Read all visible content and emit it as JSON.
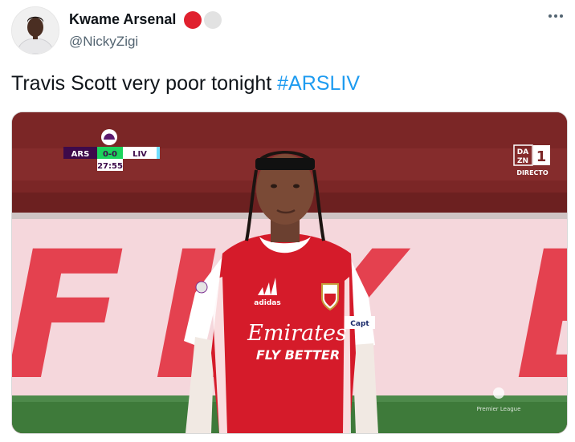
{
  "author": {
    "display_name": "Kwame Arsenal",
    "handle": "@NickyZigi",
    "badges": [
      "red-circle",
      "white-circle"
    ]
  },
  "tweet": {
    "text": "Travis Scott very poor tonight ",
    "hashtag": "#ARSLIV"
  },
  "media": {
    "scoreboard": {
      "home": "ARS",
      "score": "0-0",
      "away": "LIV",
      "clock": "27:55"
    },
    "broadcaster": {
      "logo_top": "DA",
      "logo_bottom": "ZN",
      "channel": "1",
      "status": "DIRECTO"
    },
    "shirt": {
      "sponsor_line1": "Emirates",
      "sponsor_line2": "FLY BETTER",
      "brand": "adidas",
      "armband": "Capt"
    },
    "stadium_banner": "FLY BETTER",
    "league_logo_text": "Premier League"
  },
  "colors": {
    "hashtag": "#1d9bf0",
    "handle": "#536471",
    "arsenal_red": "#d51b2a",
    "score_green": "#1bd45c"
  }
}
